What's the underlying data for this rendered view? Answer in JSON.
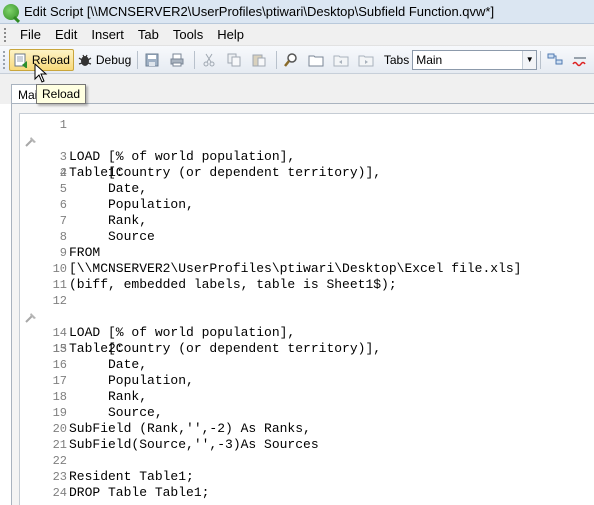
{
  "window": {
    "title": "Edit Script [\\\\MCNSERVER2\\UserProfiles\\ptiwari\\Desktop\\Subfield Function.qvw*]"
  },
  "menu": [
    "File",
    "Edit",
    "Insert",
    "Tab",
    "Tools",
    "Help"
  ],
  "toolbar": {
    "reload_label": "Reload",
    "debug_label": "Debug",
    "tabs_label": "Tabs",
    "tabs_selected": "Main"
  },
  "tooltip": {
    "text": "Reload"
  },
  "doc_tab": {
    "label": "Main"
  },
  "colors": {
    "keyword": "#0000c8",
    "line_number": "#808080",
    "tooltip_bg": "#ffffe1",
    "pressed_btn": "#f8d97b"
  },
  "editor": {
    "lines": [
      {
        "n": "1",
        "text": ""
      },
      {
        "n": "2",
        "text": "Table1:"
      },
      {
        "n": "3",
        "text": "LOAD [% of world population],"
      },
      {
        "n": "4",
        "text": "     [Country (or dependent territory)],"
      },
      {
        "n": "5",
        "text": "     Date,"
      },
      {
        "n": "6",
        "text": "     Population,"
      },
      {
        "n": "7",
        "text": "     Rank,"
      },
      {
        "n": "8",
        "text": "     Source"
      },
      {
        "n": "9",
        "text": "FROM"
      },
      {
        "n": "10",
        "text": "[\\\\MCNSERVER2\\UserProfiles\\ptiwari\\Desktop\\Excel file.xls]"
      },
      {
        "n": "11",
        "text": "(biff, embedded labels, table is Sheet1$);"
      },
      {
        "n": "12",
        "text": ""
      },
      {
        "n": "13",
        "text": "Table2:"
      },
      {
        "n": "14",
        "text": "LOAD [% of world population],"
      },
      {
        "n": "15",
        "text": "     [Country (or dependent territory)],"
      },
      {
        "n": "16",
        "text": "     Date,"
      },
      {
        "n": "17",
        "text": "     Population,"
      },
      {
        "n": "18",
        "text": "     Rank,"
      },
      {
        "n": "19",
        "text": "     Source,"
      },
      {
        "n": "20",
        "text": "SubField (Rank,'',-2) As Ranks,"
      },
      {
        "n": "21",
        "text": "SubField(Source,'',-3)As Sources"
      },
      {
        "n": "22",
        "text": ""
      },
      {
        "n": "23",
        "text": "Resident Table1;"
      },
      {
        "n": "24",
        "text": "DROP Table Table1;"
      }
    ]
  }
}
